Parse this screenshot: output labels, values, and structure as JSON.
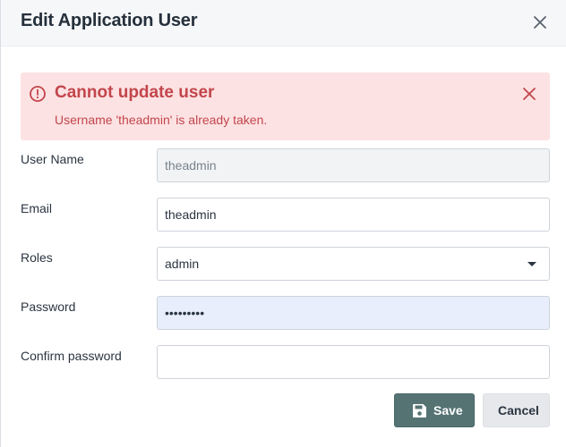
{
  "dialog": {
    "title": "Edit Application User",
    "close_icon": "close-icon"
  },
  "alert": {
    "icon": "error-circle-icon",
    "title": "Cannot update user",
    "message": "Username 'theadmin' is already taken.",
    "close_icon": "close-icon",
    "colors": {
      "background": "#fde2e3",
      "text": "#c2464c"
    }
  },
  "form": {
    "username": {
      "label": "User Name",
      "value": "theadmin",
      "disabled": true
    },
    "email": {
      "label": "Email",
      "value": "theadmin"
    },
    "roles": {
      "label": "Roles",
      "value": "admin"
    },
    "password": {
      "label": "Password",
      "value": "•••••••••"
    },
    "confirm_password": {
      "label": "Confirm password",
      "value": ""
    }
  },
  "buttons": {
    "save_label": "Save",
    "save_icon": "floppy-disk-icon",
    "cancel_label": "Cancel"
  },
  "colors": {
    "primary": "#567374",
    "header_bg": "#f6f7f9"
  }
}
